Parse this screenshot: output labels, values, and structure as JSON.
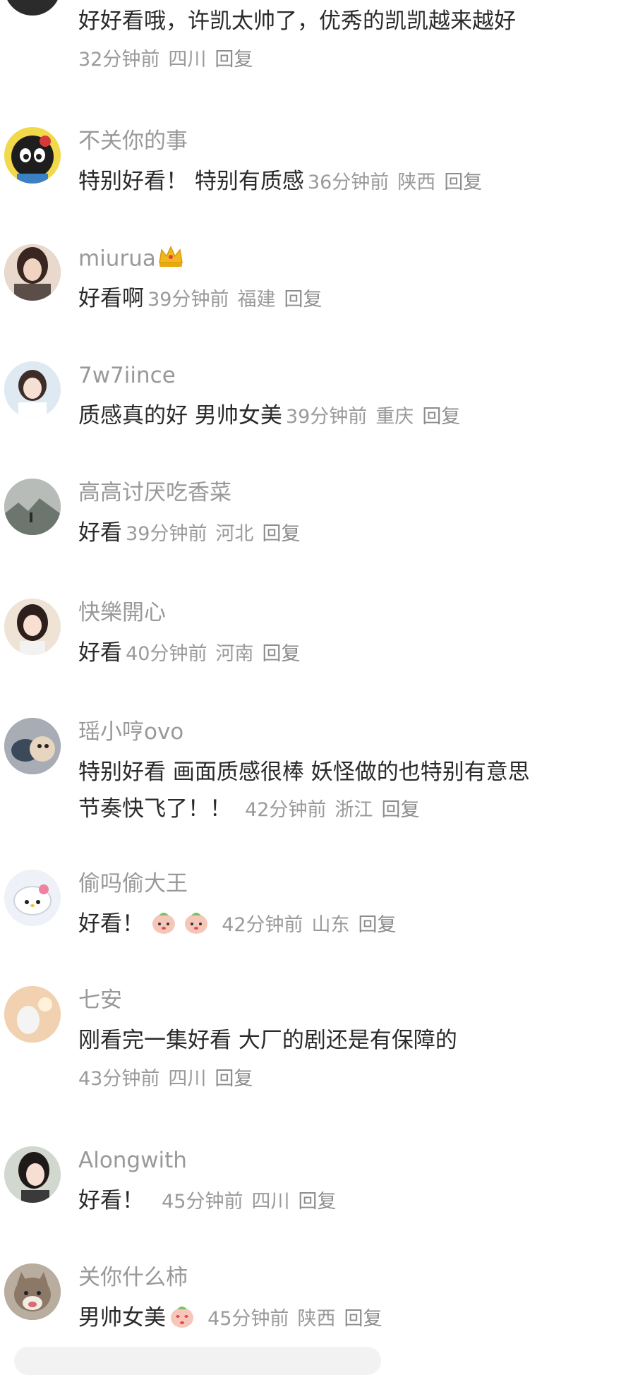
{
  "comments": [
    {
      "text": "好好看哦，许凯太帅了，优秀的凯凯越来越好",
      "time": "32分钟前",
      "region": "四川",
      "reply": "回复"
    },
    {
      "user": "不关你的事",
      "text": "特别好看！ 特别有质感",
      "time": "36分钟前",
      "region": "陕西",
      "reply": "回复"
    },
    {
      "user": "miurua",
      "text": "好看啊",
      "time": "39分钟前",
      "region": "福建",
      "reply": "回复"
    },
    {
      "user": "7w7iince",
      "text": "质感真的好 男帅女美",
      "time": "39分钟前",
      "region": "重庆",
      "reply": "回复"
    },
    {
      "user": "高高讨厌吃香菜",
      "text": "好看",
      "time": "39分钟前",
      "region": "河北",
      "reply": "回复"
    },
    {
      "user": "快樂開心",
      "text": "好看",
      "time": "40分钟前",
      "region": "河南",
      "reply": "回复"
    },
    {
      "user": "瑶小哼ovo",
      "text": "特别好看 画面质感很棒 妖怪做的也特别有意思",
      "text2": "节奏快飞了！！",
      "time": "42分钟前",
      "region": "浙江",
      "reply": "回复"
    },
    {
      "user": "偷吗偷大王",
      "text": "好看！",
      "time": "42分钟前",
      "region": "山东",
      "reply": "回复"
    },
    {
      "user": "七安",
      "text": "刚看完一集好看 大厂的剧还是有保障的",
      "time": "43分钟前",
      "region": "四川",
      "reply": "回复"
    },
    {
      "user": "Alongwith",
      "text": "好看！",
      "time": "45分钟前",
      "region": "四川",
      "reply": "回复"
    },
    {
      "user": "关你什么柿",
      "text": "男帅女美",
      "time": "45分钟前",
      "region": "陕西",
      "reply": "回复"
    }
  ],
  "colors": {
    "username": "#999999",
    "body": "#2a2a2a",
    "meta": "#9a9a9a"
  }
}
